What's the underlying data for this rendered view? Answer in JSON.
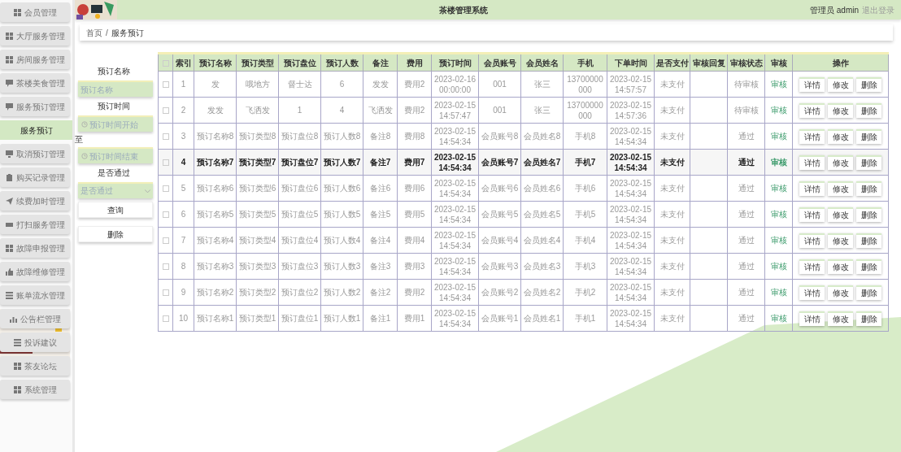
{
  "header": {
    "title": "茶楼管理系统",
    "user": "管理员 admin",
    "logout": "退出登录"
  },
  "sidebar": {
    "items": [
      {
        "label": "会员管理",
        "selected": false
      },
      {
        "label": "大厅服务管理",
        "selected": false
      },
      {
        "label": "房间服务管理",
        "selected": false
      },
      {
        "label": "茶楼美食管理",
        "selected": false
      },
      {
        "label": "服务预订管理",
        "selected": false,
        "children": [
          {
            "label": "服务预订",
            "selected": true
          }
        ]
      },
      {
        "label": "取消预订管理",
        "selected": false
      },
      {
        "label": "购买记录管理",
        "selected": false
      },
      {
        "label": "续费加时管理",
        "selected": false
      },
      {
        "label": "打扫服务管理",
        "selected": false
      },
      {
        "label": "故障申报管理",
        "selected": false
      },
      {
        "label": "故障维修管理",
        "selected": false
      },
      {
        "label": "账单流水管理",
        "selected": false
      },
      {
        "label": "公告栏管理",
        "selected": false
      },
      {
        "label": "投诉建议",
        "selected": false
      },
      {
        "label": "茶友论坛",
        "selected": false
      },
      {
        "label": "系统管理",
        "selected": false
      }
    ]
  },
  "breadcrumb": {
    "items": [
      "首页",
      "服务预订"
    ],
    "separator": "/"
  },
  "search": {
    "fields": [
      {
        "kind": "text",
        "label": "预订名称",
        "placeholder": "预订名称"
      },
      {
        "kind": "date_range",
        "label": "预订时间",
        "placeholder": "预订时间开始",
        "separator": "至",
        "placeholder_end": "预订时间结束"
      },
      {
        "kind": "select",
        "label": "是否通过",
        "placeholder": "是否通过"
      }
    ],
    "buttons": [
      "查询",
      "删除"
    ]
  },
  "table": {
    "select_all": {
      "checked": false
    },
    "columns": [
      "索引",
      "预订名称",
      "预订类型",
      "预订盘位",
      "预订人数",
      "备注",
      "费用",
      "预订时间",
      "会员账号",
      "会员姓名",
      "手机",
      "下单时间",
      "是否支付",
      "审核回复",
      "审核状态",
      "审核",
      "操作"
    ],
    "rows": [
      {
        "checked": false,
        "hovered": false,
        "cells": [
          "1",
          "发",
          "哦地方",
          "督士达",
          "6",
          "发发",
          "费用2",
          "2023-02-16 00:00:00",
          "001",
          "张三",
          "13700000000",
          "2023-02-15 14:57:57",
          "未支付",
          "",
          "待审核"
        ],
        "review": "审核",
        "actions": [
          "详情",
          "修改",
          "删除"
        ]
      },
      {
        "checked": false,
        "hovered": false,
        "cells": [
          "2",
          "发发",
          "飞洒发",
          "1",
          "4",
          "飞洒发",
          "费用2",
          "2023-02-15 14:57:47",
          "001",
          "张三",
          "13700000000",
          "2023-02-15 14:57:36",
          "未支付",
          "",
          "待审核"
        ],
        "review": "审核",
        "actions": [
          "详情",
          "修改",
          "删除"
        ]
      },
      {
        "checked": false,
        "hovered": false,
        "cells": [
          "3",
          "预订名称8",
          "预订类型8",
          "预订盘位8",
          "预订人数8",
          "备注8",
          "费用8",
          "2023-02-15 14:54:34",
          "会员账号8",
          "会员姓名8",
          "手机8",
          "2023-02-15 14:54:34",
          "未支付",
          "",
          "通过"
        ],
        "review": "审核",
        "actions": [
          "详情",
          "修改",
          "删除"
        ]
      },
      {
        "checked": false,
        "hovered": true,
        "cells": [
          "4",
          "预订名称7",
          "预订类型7",
          "预订盘位7",
          "预订人数7",
          "备注7",
          "费用7",
          "2023-02-15 14:54:34",
          "会员账号7",
          "会员姓名7",
          "手机7",
          "2023-02-15 14:54:34",
          "未支付",
          "",
          "通过"
        ],
        "review": "审核",
        "actions": [
          "详情",
          "修改",
          "删除"
        ]
      },
      {
        "checked": false,
        "hovered": false,
        "cells": [
          "5",
          "预订名称6",
          "预订类型6",
          "预订盘位6",
          "预订人数6",
          "备注6",
          "费用6",
          "2023-02-15 14:54:34",
          "会员账号6",
          "会员姓名6",
          "手机6",
          "2023-02-15 14:54:34",
          "未支付",
          "",
          "通过"
        ],
        "review": "审核",
        "actions": [
          "详情",
          "修改",
          "删除"
        ]
      },
      {
        "checked": false,
        "hovered": false,
        "cells": [
          "6",
          "预订名称5",
          "预订类型5",
          "预订盘位5",
          "预订人数5",
          "备注5",
          "费用5",
          "2023-02-15 14:54:34",
          "会员账号5",
          "会员姓名5",
          "手机5",
          "2023-02-15 14:54:34",
          "未支付",
          "",
          "通过"
        ],
        "review": "审核",
        "actions": [
          "详情",
          "修改",
          "删除"
        ]
      },
      {
        "checked": false,
        "hovered": false,
        "cells": [
          "7",
          "预订名称4",
          "预订类型4",
          "预订盘位4",
          "预订人数4",
          "备注4",
          "费用4",
          "2023-02-15 14:54:34",
          "会员账号4",
          "会员姓名4",
          "手机4",
          "2023-02-15 14:54:34",
          "未支付",
          "",
          "通过"
        ],
        "review": "审核",
        "actions": [
          "详情",
          "修改",
          "删除"
        ]
      },
      {
        "checked": false,
        "hovered": false,
        "cells": [
          "8",
          "预订名称3",
          "预订类型3",
          "预订盘位3",
          "预订人数3",
          "备注3",
          "费用3",
          "2023-02-15 14:54:34",
          "会员账号3",
          "会员姓名3",
          "手机3",
          "2023-02-15 14:54:34",
          "未支付",
          "",
          "通过"
        ],
        "review": "审核",
        "actions": [
          "详情",
          "修改",
          "删除"
        ]
      },
      {
        "checked": false,
        "hovered": false,
        "cells": [
          "9",
          "预订名称2",
          "预订类型2",
          "预订盘位2",
          "预订人数2",
          "备注2",
          "费用2",
          "2023-02-15 14:54:34",
          "会员账号2",
          "会员姓名2",
          "手机2",
          "2023-02-15 14:54:34",
          "未支付",
          "",
          "通过"
        ],
        "review": "审核",
        "actions": [
          "详情",
          "修改",
          "删除"
        ]
      },
      {
        "checked": false,
        "hovered": false,
        "cells": [
          "10",
          "预订名称1",
          "预订类型1",
          "预订盘位1",
          "预订人数1",
          "备注1",
          "费用1",
          "2023-02-15 14:54:34",
          "会员账号1",
          "会员姓名1",
          "手机1",
          "2023-02-15 14:54:34",
          "未支付",
          "",
          "通过"
        ],
        "review": "审核",
        "actions": [
          "详情",
          "修改",
          "删除"
        ]
      }
    ]
  }
}
